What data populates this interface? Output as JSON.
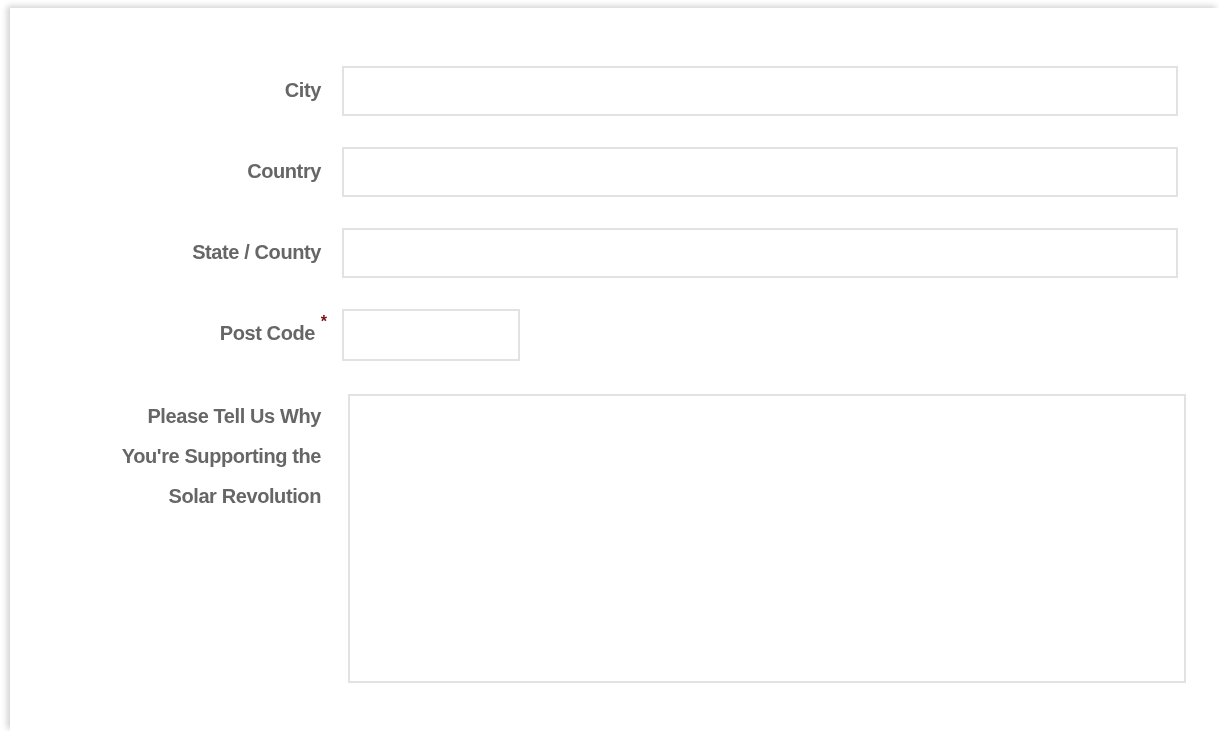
{
  "form": {
    "fields": [
      {
        "label": "City",
        "kind": "text"
      },
      {
        "label": "Country",
        "kind": "text"
      },
      {
        "label": "State / County",
        "kind": "text"
      },
      {
        "label": "Post Code",
        "kind": "short",
        "marker": "*"
      },
      {
        "label": "Please Tell Us Why You're Supporting the Solar Revolution",
        "kind": "textarea"
      }
    ]
  }
}
